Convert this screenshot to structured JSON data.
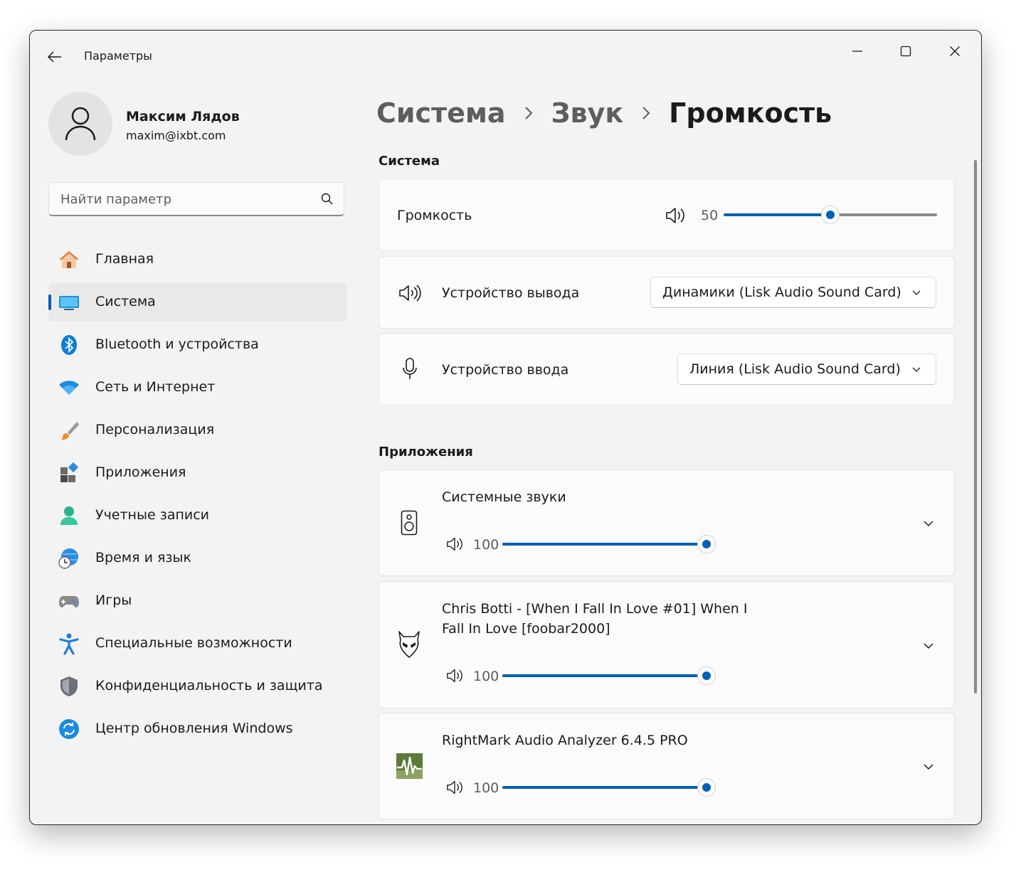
{
  "window": {
    "title": "Параметры",
    "controls": {
      "minimize": "minimize-icon",
      "maximize": "maximize-icon",
      "close": "close-icon"
    }
  },
  "user": {
    "name": "Максим Лядов",
    "email": "maxim@ixbt.com"
  },
  "search": {
    "placeholder": "Найти параметр"
  },
  "sidebar": {
    "selected_index": 1,
    "items": [
      {
        "label": "Главная",
        "icon": "home-icon"
      },
      {
        "label": "Система",
        "icon": "monitor-icon"
      },
      {
        "label": "Bluetooth и устройства",
        "icon": "bluetooth-icon"
      },
      {
        "label": "Сеть и Интернет",
        "icon": "wifi-icon"
      },
      {
        "label": "Персонализация",
        "icon": "brush-icon"
      },
      {
        "label": "Приложения",
        "icon": "apps-icon"
      },
      {
        "label": "Учетные записи",
        "icon": "account-icon"
      },
      {
        "label": "Время и язык",
        "icon": "globe-clock-icon"
      },
      {
        "label": "Игры",
        "icon": "gamepad-icon"
      },
      {
        "label": "Специальные возможности",
        "icon": "accessibility-icon"
      },
      {
        "label": "Конфиденциальность и защита",
        "icon": "shield-icon"
      },
      {
        "label": "Центр обновления Windows",
        "icon": "update-icon"
      }
    ]
  },
  "breadcrumb": {
    "items": [
      "Система",
      "Звук",
      "Громкость"
    ]
  },
  "system_section": {
    "header": "Система",
    "volume": {
      "label": "Громкость",
      "value": "50",
      "level": 0.5
    },
    "output": {
      "label": "Устройство вывода",
      "value": "Динамики (Lisk Audio Sound Card)"
    },
    "input": {
      "label": "Устройство ввода",
      "value": "Линия (Lisk Audio Sound Card)"
    }
  },
  "apps_section": {
    "header": "Приложения",
    "apps": [
      {
        "name": "Системные звуки",
        "value": "100",
        "level": 1.0,
        "icon": "speaker-device-icon"
      },
      {
        "name_line1": "Chris Botti - [When I Fall In Love #01] When I",
        "name_line2": "Fall In Love  [foobar2000]",
        "value": "100",
        "level": 1.0,
        "icon": "foobar-alien-icon"
      },
      {
        "name": "RightMark Audio Analyzer 6.4.5 PRO",
        "value": "100",
        "level": 1.0,
        "icon": "rightmark-icon"
      }
    ]
  },
  "colors": {
    "accent": "#005fb8",
    "window_bg": "#f3f3f3",
    "card_bg": "#fbfbfb"
  }
}
